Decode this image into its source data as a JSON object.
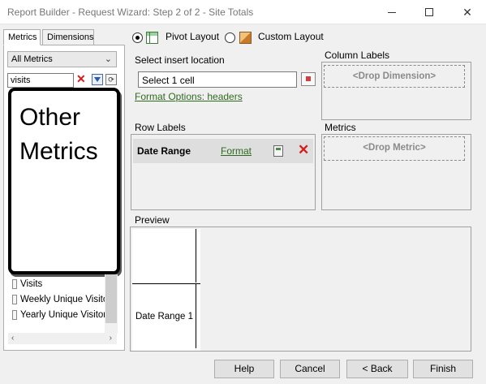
{
  "window": {
    "title": "Report Builder - Request Wizard: Step 2 of 2 - Site Totals"
  },
  "left_panel": {
    "tabs": [
      "Metrics",
      "Dimensions"
    ],
    "metric_group": "All Metrics",
    "search_value": "visits",
    "callout_lines": [
      "Other",
      "Metrics"
    ],
    "metric_items": [
      "Visits",
      "Weekly Unique Visitors",
      "Yearly Unique Visitors"
    ]
  },
  "layout_options": {
    "pivot": "Pivot Layout",
    "custom": "Custom Layout",
    "selected": "Pivot Layout"
  },
  "insert": {
    "label": "Select insert location",
    "value": "Select 1 cell",
    "format_link": "Format Options: headers"
  },
  "column_labels": {
    "heading": "Column Labels",
    "drop": "<Drop Dimension>"
  },
  "row_labels": {
    "heading": "Row Labels",
    "item": "Date Range",
    "format": "Format"
  },
  "metrics_area": {
    "heading": "Metrics",
    "drop": "<Drop Metric>"
  },
  "preview": {
    "heading": "Preview",
    "cell": "Date Range 1"
  },
  "buttons": {
    "help": "Help",
    "cancel": "Cancel",
    "back": "< Back",
    "finish": "Finish"
  }
}
